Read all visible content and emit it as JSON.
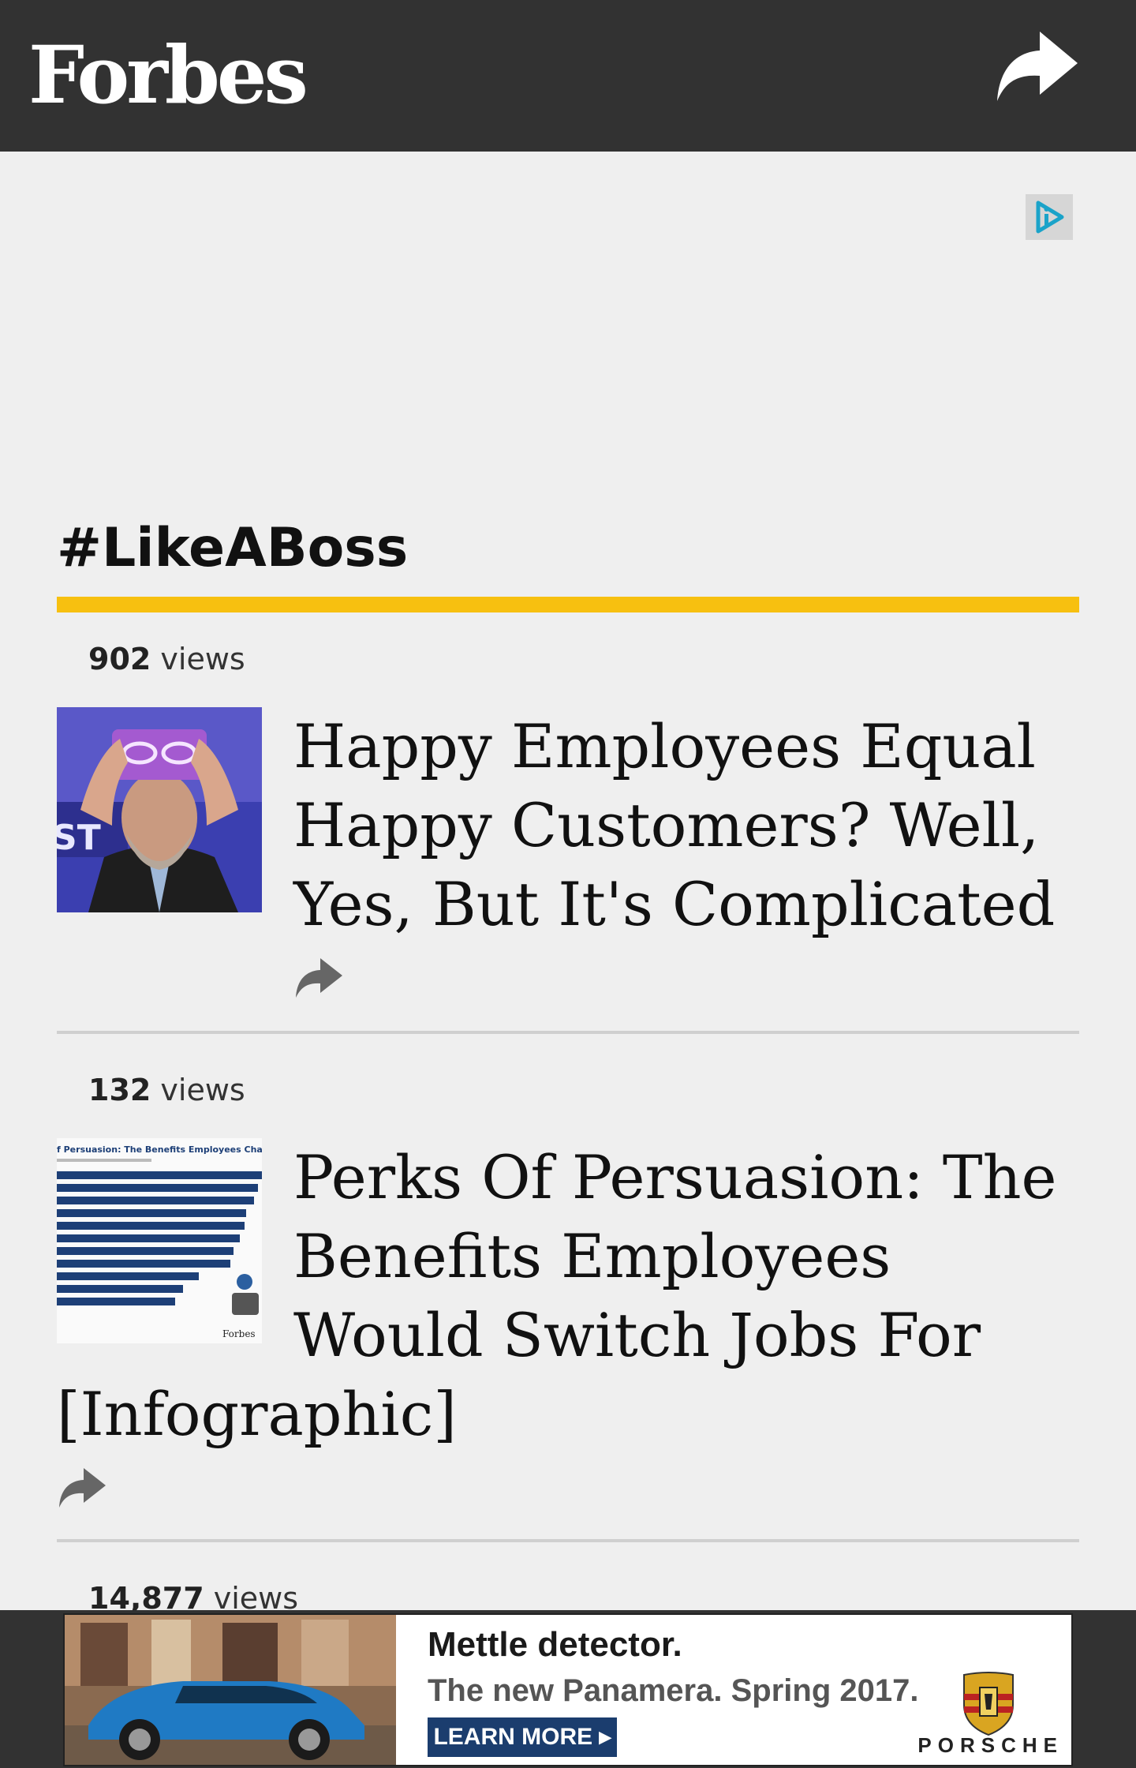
{
  "header": {
    "logo": "Forbes",
    "share_icon": "share-arrow-icon"
  },
  "ad_top": {
    "adchoices_icon": "adchoices-icon"
  },
  "section": {
    "title": "#LikeABoss",
    "accent_color": "#f7c010"
  },
  "articles": [
    {
      "views_count": "902",
      "views_label": "views",
      "title": "Happy Employees Equal Happy Customers? Well, Yes, But It's Complicated",
      "thumbnail": "man-holding-vr-headset-photo"
    },
    {
      "views_count": "132",
      "views_label": "views",
      "title": "Perks Of Persuasion: The Benefits Employees Would Switch Jobs For [Infographic]",
      "thumbnail": "infographic-bar-chart",
      "thumb_title": "f Persuasion: The Benefits Employees Change J",
      "thumb_brand": "Forbes"
    },
    {
      "views_count": "14,877",
      "views_label": "views"
    }
  ],
  "bottom_ad": {
    "headline": "Mettle detector.",
    "subline": "The new Panamera. Spring 2017.",
    "cta": "LEARN MORE ▸",
    "brand": "PORSCHE"
  }
}
